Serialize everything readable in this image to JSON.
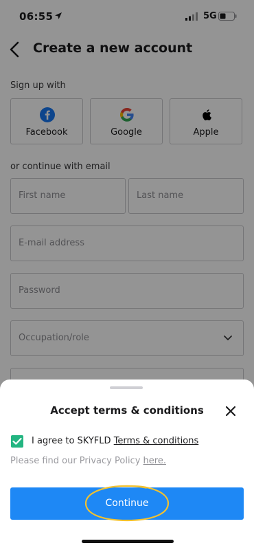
{
  "status_bar": {
    "time": "06:55",
    "network": "5G"
  },
  "header": {
    "title": "Create a new account"
  },
  "signup": {
    "label": "Sign up with",
    "providers": [
      {
        "label": "Facebook",
        "icon": "facebook-icon",
        "color": "#1877F2"
      },
      {
        "label": "Google",
        "icon": "google-icon"
      },
      {
        "label": "Apple",
        "icon": "apple-icon",
        "color": "#000000"
      }
    ]
  },
  "email_section": {
    "label": "or continue with email",
    "first_name_placeholder": "First name",
    "last_name_placeholder": "Last name",
    "email_placeholder": "E-mail address",
    "password_placeholder": "Password",
    "occupation_placeholder": "Occupation/role"
  },
  "sheet": {
    "title": "Accept terms & conditions",
    "agree_prefix": "I agree to SKYFLD ",
    "agree_link": "Terms & conditions",
    "checkbox_checked": true,
    "privacy_prefix": "Please find our Privacy Policy ",
    "privacy_link": "here.",
    "continue_label": "Continue"
  },
  "colors": {
    "primary": "#1E88F5",
    "checkbox": "#23B581",
    "highlight": "#F2C12E"
  }
}
